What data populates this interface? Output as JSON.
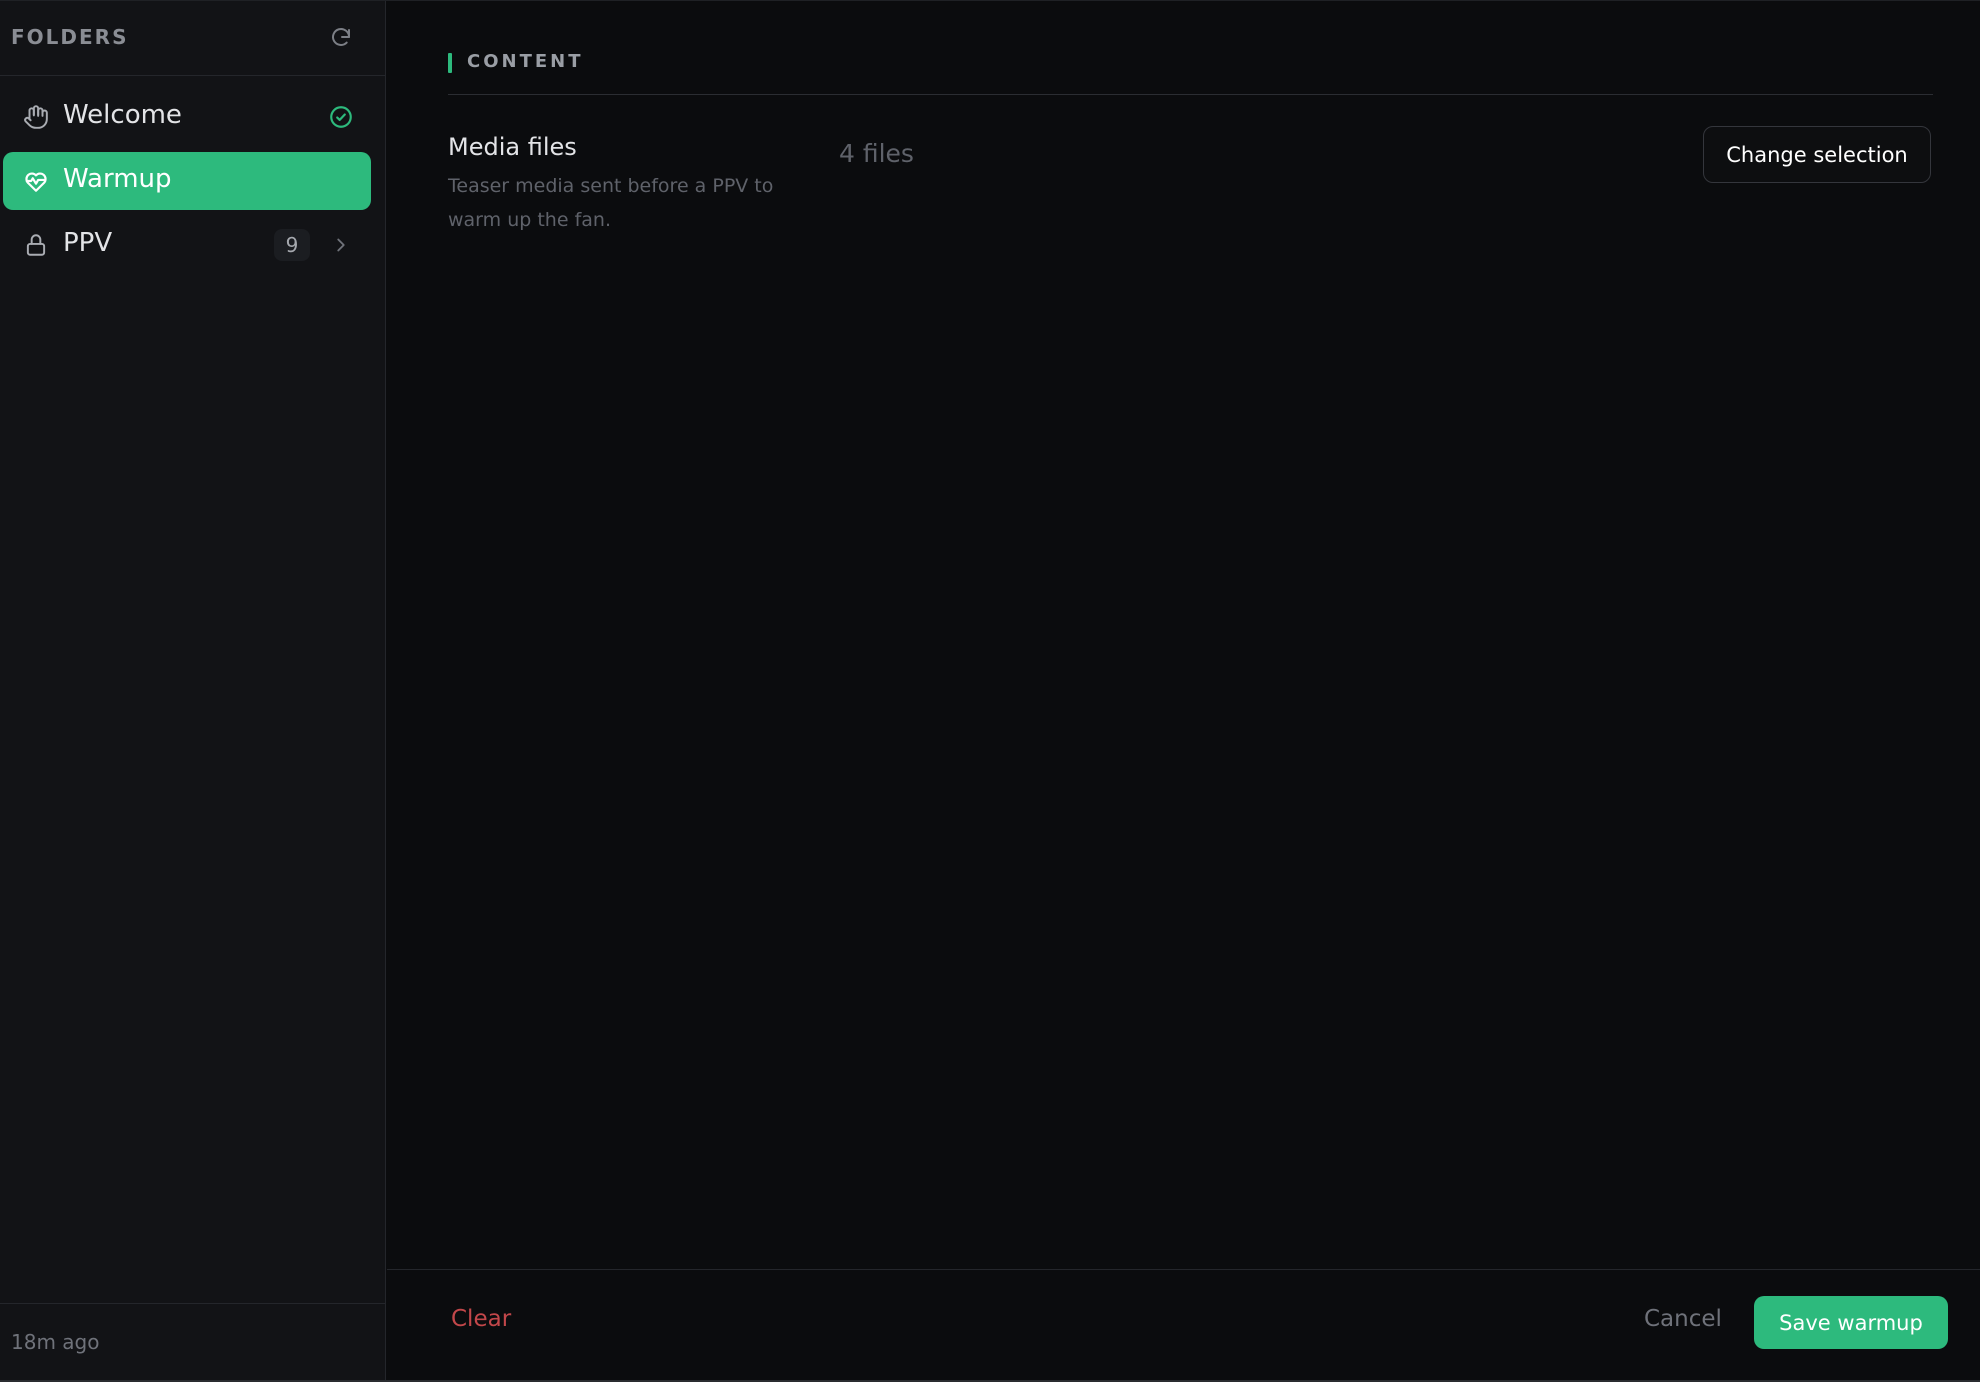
{
  "sidebar": {
    "title": "FOLDERS",
    "refresh_icon": "refresh-icon",
    "items": [
      {
        "label": "Welcome",
        "icon": "hand-icon",
        "status": "check-circle-icon",
        "active": false
      },
      {
        "label": "Warmup",
        "icon": "heart-pulse-icon",
        "active": true
      },
      {
        "label": "PPV",
        "icon": "lock-icon",
        "count": "9",
        "trailing": "chevron-right-icon",
        "active": false
      }
    ],
    "footer": {
      "updated": "18m ago"
    }
  },
  "main": {
    "section": {
      "title": "CONTENT"
    },
    "media": {
      "label": "Media files",
      "description": "Teaser media sent before a PPV to warm up the fan.",
      "value": "4 files",
      "change_label": "Change selection"
    }
  },
  "footer": {
    "clear_label": "Clear",
    "cancel_label": "Cancel",
    "save_label": "Save warmup"
  },
  "colors": {
    "accent": "#2dba7d",
    "danger": "#c2474a",
    "background": "#0b0c0e",
    "sidebar": "#121316"
  }
}
